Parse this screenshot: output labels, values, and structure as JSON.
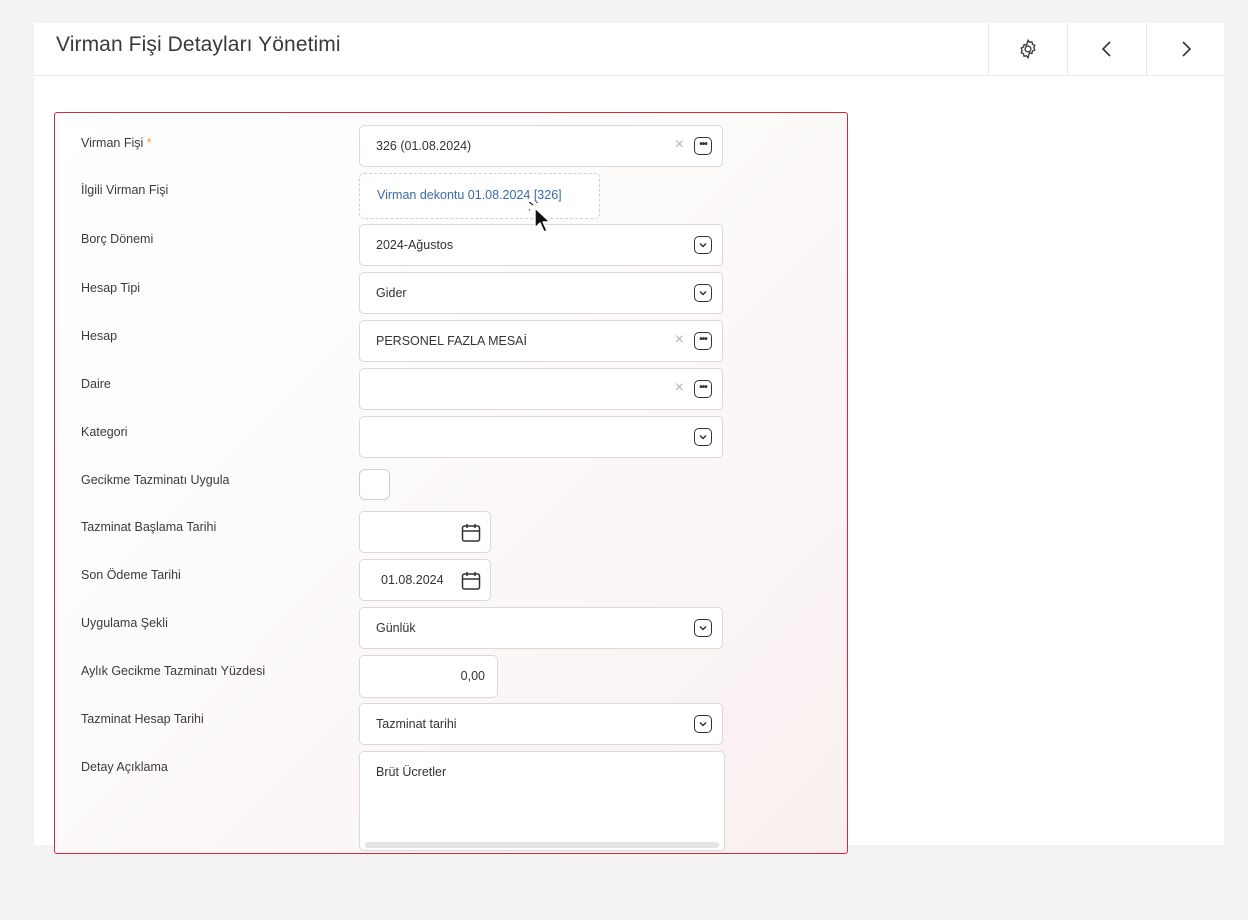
{
  "header": {
    "title": "Virman Fişi Detayları Yönetimi",
    "buttons": [
      "gear-icon",
      "chevron-left-icon",
      "chevron-right-icon"
    ]
  },
  "form": {
    "virman_fisi": {
      "label": "Virman Fişi",
      "required_mark": "*",
      "value": "326 (01.08.2024)",
      "clear": "×"
    },
    "ilgili_virman_fisi": {
      "label": "İlgili Virman Fişi",
      "value": "Virman dekontu 01.08.2024 [326]"
    },
    "borc_donemi": {
      "label": "Borç Dönemi",
      "value": "2024-Ağustos"
    },
    "hesap_tipi": {
      "label": "Hesap Tipi",
      "value": "Gider"
    },
    "hesap": {
      "label": "Hesap",
      "value": "PERSONEL FAZLA MESAİ",
      "clear": "×"
    },
    "daire": {
      "label": "Daire",
      "value": "",
      "clear": "×"
    },
    "kategori": {
      "label": "Kategori",
      "value": ""
    },
    "gecikme_tazminati": {
      "label": "Gecikme Tazminatı Uygula",
      "checked": false
    },
    "tazminat_baslama": {
      "label": "Tazminat Başlama Tarihi",
      "value": ""
    },
    "son_odeme": {
      "label": "Son Ödeme Tarihi",
      "value": "01.08.2024"
    },
    "uygulama_sekli": {
      "label": "Uygulama Şekli",
      "value": "Günlük"
    },
    "aylik_gecikme": {
      "label": "Aylık Gecikme Tazminatı Yüzdesi",
      "value": "0,00"
    },
    "tazminat_hesap_tarihi": {
      "label": "Tazminat Hesap Tarihi",
      "value": "Tazminat tarihi"
    },
    "detay_aciklama": {
      "label": "Detay Açıklama",
      "value": "Brüt Ücretler"
    }
  },
  "colors": {
    "accent_border": "#d3293a",
    "required": "#f29b38",
    "link": "#3b6aa8"
  }
}
